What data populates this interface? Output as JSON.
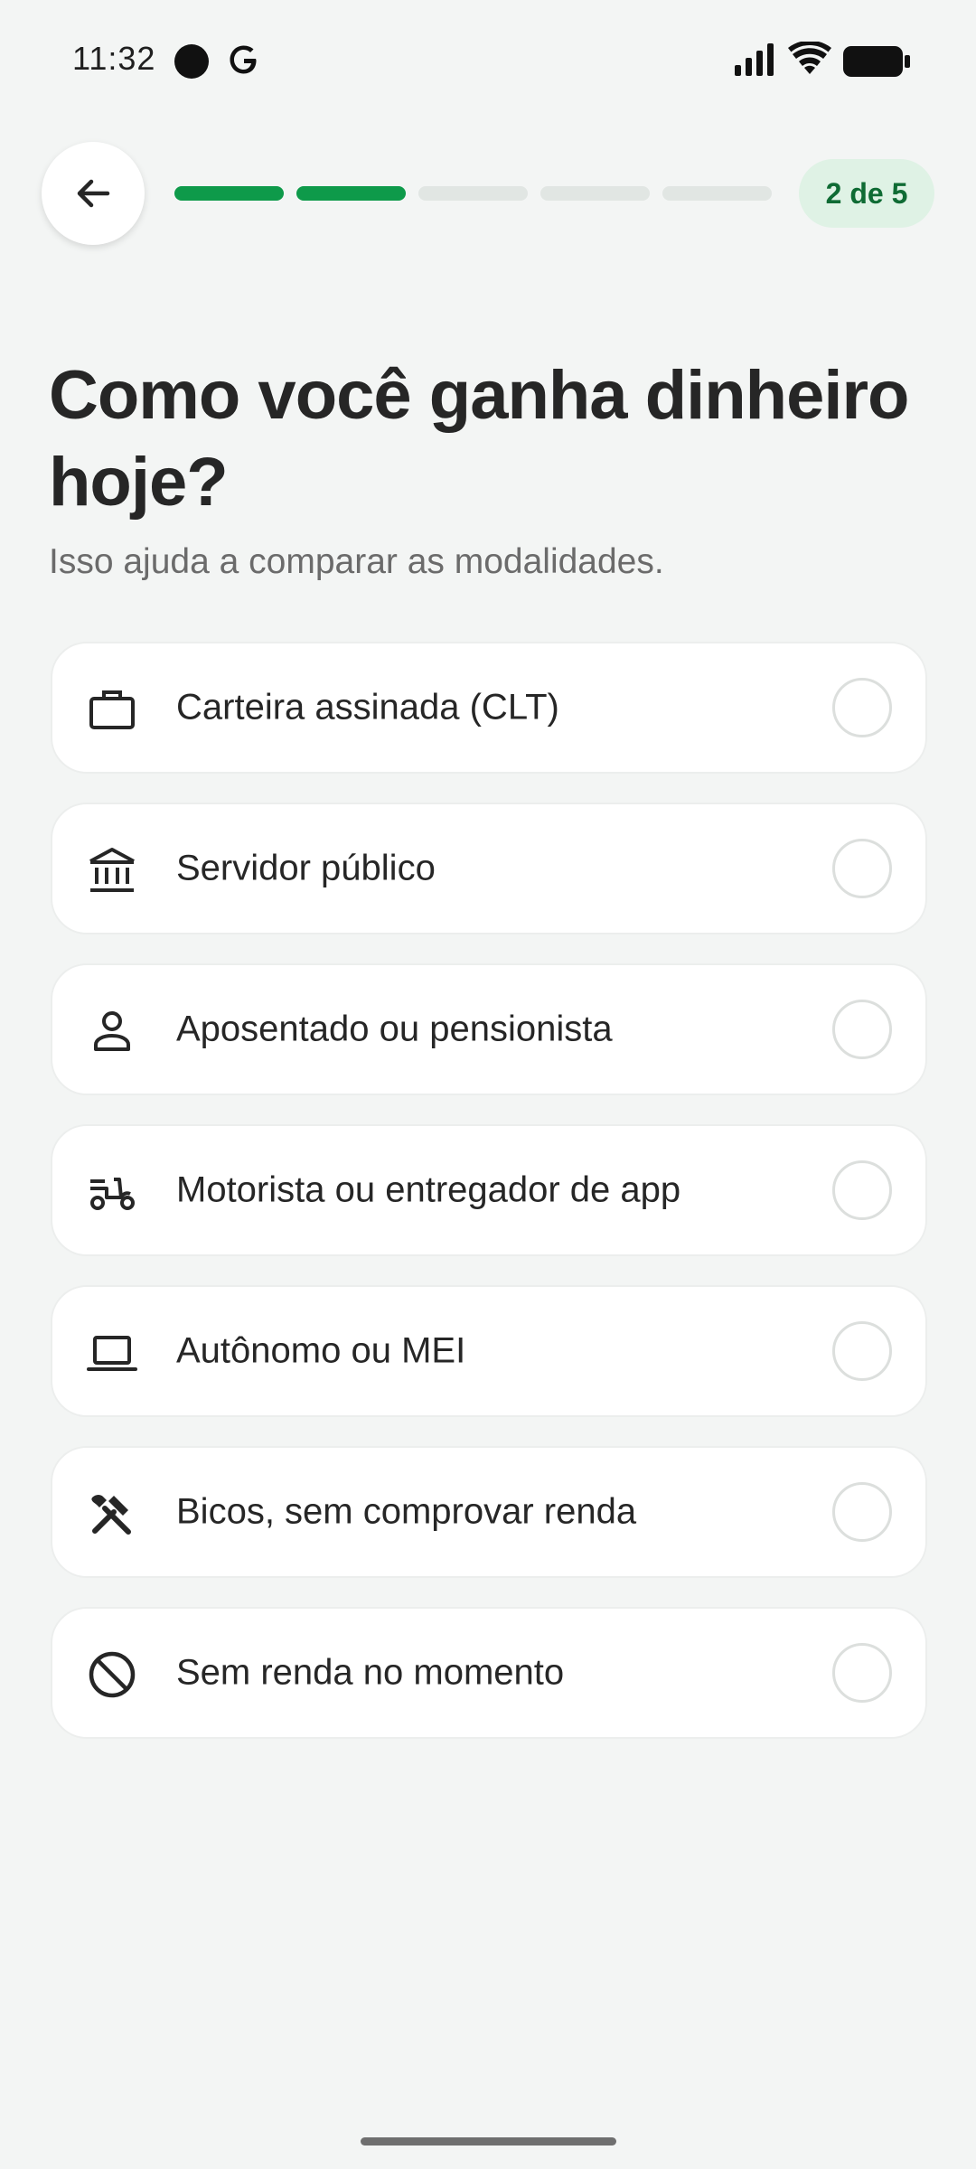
{
  "status_bar": {
    "time": "11:32"
  },
  "header": {
    "back_label": "Voltar",
    "progress": {
      "current": 2,
      "total": 5
    },
    "step_label": "2 de 5"
  },
  "title": "Como você ganha dinheiro hoje?",
  "subtitle": "Isso ajuda a comparar as modalidades.",
  "options": [
    {
      "icon": "briefcase-icon",
      "label": "Carteira assinada (CLT)",
      "selected": false
    },
    {
      "icon": "bank-icon",
      "label": "Servidor público",
      "selected": false
    },
    {
      "icon": "person-icon",
      "label": "Aposentado ou pensionista",
      "selected": false
    },
    {
      "icon": "moped-icon",
      "label": "Motorista ou entregador de app",
      "selected": false
    },
    {
      "icon": "laptop-icon",
      "label": "Autônomo ou MEI",
      "selected": false
    },
    {
      "icon": "tools-icon",
      "label": "Bicos, sem comprovar renda",
      "selected": false
    },
    {
      "icon": "block-icon",
      "label": "Sem renda no momento",
      "selected": false
    }
  ],
  "colors": {
    "accent": "#0e9a4a",
    "badge_bg": "#dff2e5",
    "badge_text": "#0f6b34",
    "background": "#f3f5f4"
  }
}
